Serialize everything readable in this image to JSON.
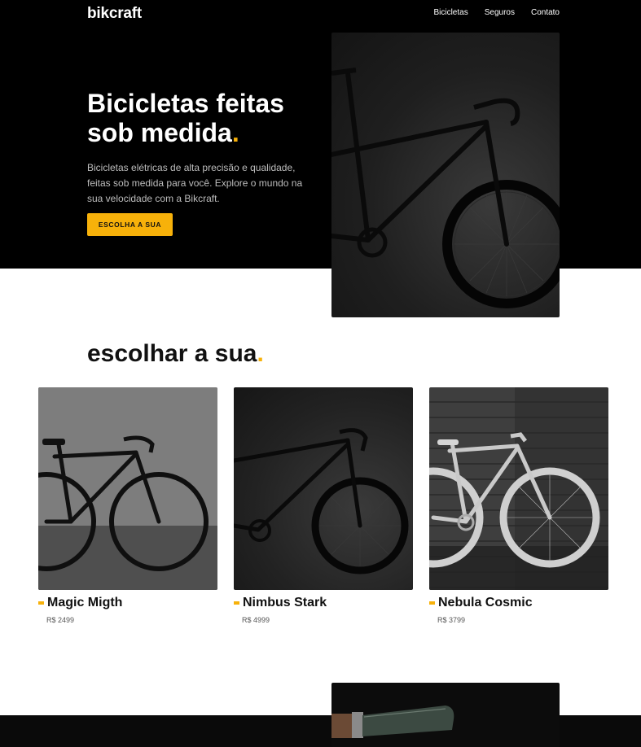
{
  "header": {
    "logo": "bikcraft",
    "nav": [
      {
        "label": "Bicicletas"
      },
      {
        "label": "Seguros"
      },
      {
        "label": "Contato"
      }
    ]
  },
  "hero": {
    "title": "Bicicletas feitas sob medida",
    "title_dot": ".",
    "description": "Bicicletas elétricas de alta precisão e qualidade, feitas sob medida para você. Explore o mundo na sua velocidade com a Bikcraft.",
    "cta_label": "ESCOLHA A SUA"
  },
  "products": {
    "title": "escolhar a sua",
    "title_dot": ".",
    "items": [
      {
        "name": "Magic Migth",
        "price": "R$ 2499"
      },
      {
        "name": "Nimbus Stark",
        "price": "R$ 4999"
      },
      {
        "name": "Nebula Cosmic",
        "price": "R$ 3799"
      }
    ]
  },
  "colors": {
    "accent": "#f7b10a",
    "dark": "#000000"
  }
}
